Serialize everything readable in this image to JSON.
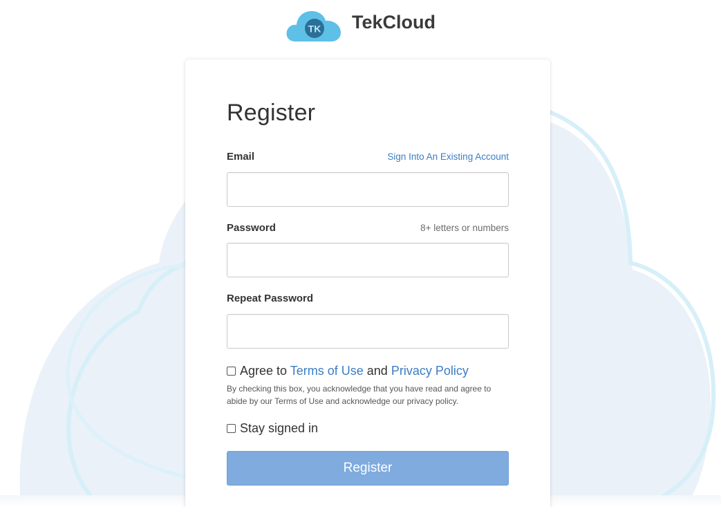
{
  "brand": {
    "name": "TekCloud",
    "logo_letters": "TK"
  },
  "form": {
    "title": "Register",
    "email": {
      "label": "Email",
      "value": "",
      "placeholder": ""
    },
    "sign_in_link": "Sign Into An Existing Account",
    "password": {
      "label": "Password",
      "hint": "8+ letters or numbers",
      "value": "",
      "placeholder": ""
    },
    "repeat_password": {
      "label": "Repeat Password",
      "value": "",
      "placeholder": ""
    },
    "agree": {
      "prefix": "Agree to",
      "terms_link": "Terms of Use",
      "conjunction": "and",
      "privacy_link": "Privacy Policy",
      "checked": false,
      "disclaimer": "By checking this box, you acknowledge that you have read and agree to abide by our Terms of Use and acknowledge our privacy policy."
    },
    "stay_signed_in": {
      "label": "Stay signed in",
      "checked": false
    },
    "submit_label": "Register"
  },
  "colors": {
    "link": "#3b7dc4",
    "button": "#7fabde",
    "logo_cloud": "#5ec0e6",
    "logo_badge": "#2a6f97",
    "background_cloud": "#eaf1f9",
    "background_cloud_outline": "#d9f0f8"
  }
}
